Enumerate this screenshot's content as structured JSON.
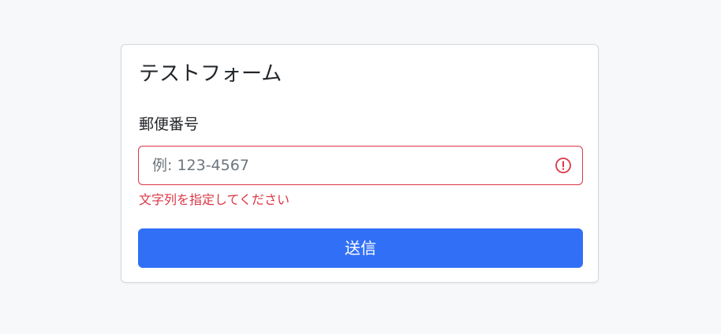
{
  "form": {
    "title": "テストフォーム",
    "postal_code": {
      "label": "郵便番号",
      "value": "",
      "placeholder": "例: 123-4567",
      "error_message": "文字列を指定してください"
    },
    "submit_label": "送信"
  },
  "icons": {
    "input_status": "exclamation-circle-icon"
  },
  "colors": {
    "background": "#f7f8fa",
    "error": "#dc3545",
    "primary": "#3170f6",
    "text": "#212529",
    "placeholder": "#6c757d"
  }
}
